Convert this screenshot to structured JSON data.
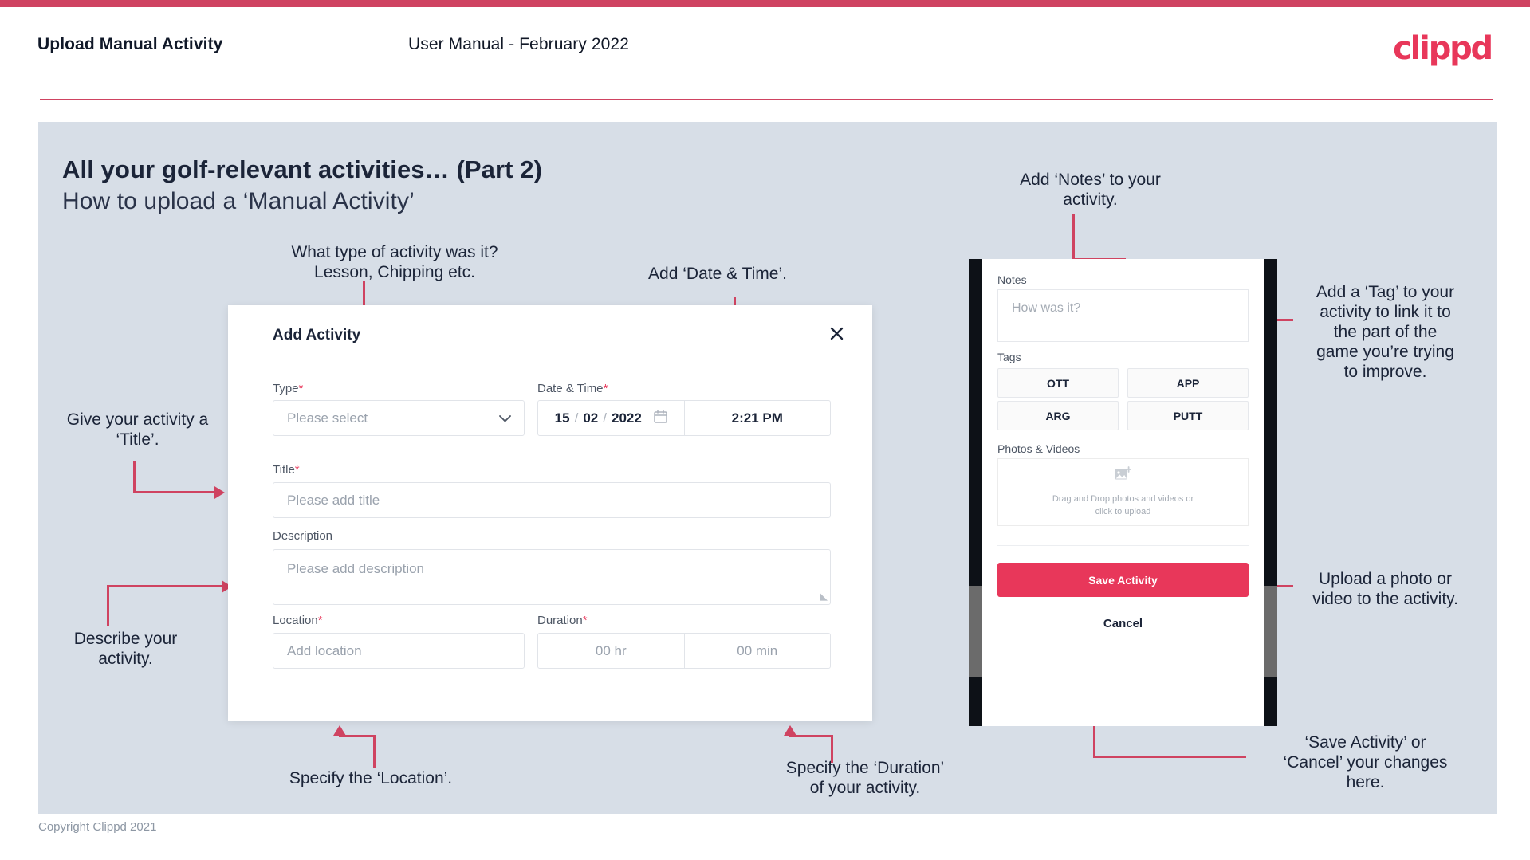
{
  "header": {
    "title": "Upload Manual Activity",
    "subtitle": "User Manual - February 2022",
    "logo": "clippd"
  },
  "slide": {
    "heading": "All your golf-relevant activities… (Part 2)",
    "subheading": "How to upload a ‘Manual Activity’"
  },
  "footer": {
    "copyright": "Copyright Clippd 2021"
  },
  "annotations": {
    "type": "What type of activity was it?\nLesson, Chipping etc.",
    "datetime": "Add ‘Date & Time’.",
    "title": "Give your activity a\n‘Title’.",
    "description": "Describe your\nactivity.",
    "location": "Specify the ‘Location’.",
    "duration": "Specify the ‘Duration’\nof your activity.",
    "notes": "Add ‘Notes’ to your\nactivity.",
    "tags": "Add a ‘Tag’ to your\nactivity to link it to\nthe part of the\ngame you’re trying\nto improve.",
    "photos": "Upload a photo or\nvideo to the activity.",
    "save_cancel": "‘Save Activity’ or\n‘Cancel’ your changes\nhere."
  },
  "dialog": {
    "title": "Add Activity",
    "close_icon": "close-icon",
    "fields": {
      "type": {
        "label": "Type",
        "required": "*",
        "placeholder": "Please select",
        "chevron_icon": "chevron-down-icon"
      },
      "datetime": {
        "label": "Date & Time",
        "required": "*",
        "day": "15",
        "month": "02",
        "year": "2022",
        "sep": "/",
        "calendar_icon": "calendar-icon",
        "time": "2:21 PM"
      },
      "title": {
        "label": "Title",
        "required": "*",
        "placeholder": "Please add title"
      },
      "description": {
        "label": "Description",
        "required": "",
        "placeholder": "Please add description"
      },
      "location": {
        "label": "Location",
        "required": "*",
        "placeholder": "Add location"
      },
      "duration": {
        "label": "Duration",
        "required": "*",
        "hours_placeholder": "00 hr",
        "minutes_placeholder": "00 min"
      }
    }
  },
  "phone": {
    "notes": {
      "label": "Notes",
      "placeholder": "How was it?"
    },
    "tags": {
      "label": "Tags",
      "items": [
        "OTT",
        "APP",
        "ARG",
        "PUTT"
      ]
    },
    "photos": {
      "label": "Photos & Videos",
      "icon": "add-image-icon",
      "hint": "Drag and Drop photos and videos or\nclick to upload"
    },
    "save_label": "Save Activity",
    "cancel_label": "Cancel"
  },
  "colors": {
    "accent": "#e8375a",
    "accent_dark": "#cf4361",
    "slide_bg": "#d7dee7",
    "text": "#1b2438"
  }
}
